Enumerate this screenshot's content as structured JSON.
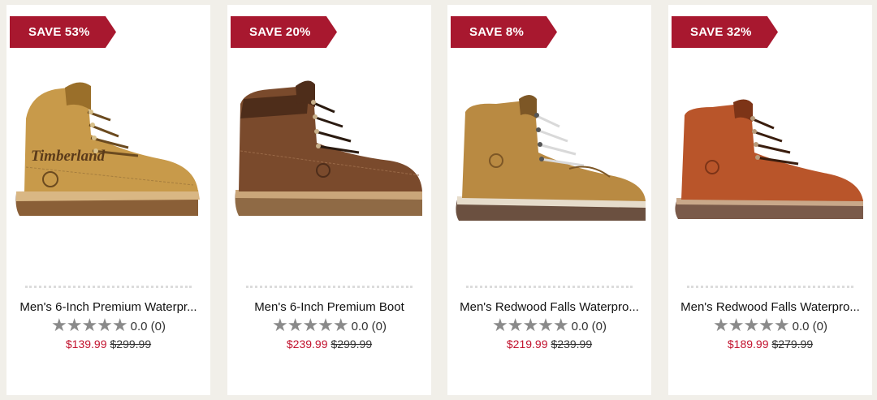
{
  "products": [
    {
      "badge": "SAVE 53%",
      "name": "Men's 6-Inch Premium Waterpr...",
      "stars": "★★★★★",
      "rating": "0.0 (0)",
      "sale_price": "$139.99",
      "original_price": "$299.99",
      "image_logo_text": "Timberland",
      "colors": {
        "upper": "#c89a4a",
        "dark": "#9a6f2a",
        "sole": "#8a5f37",
        "welt": "#d9b784"
      }
    },
    {
      "badge": "SAVE 20%",
      "name": "Men's 6-Inch Premium Boot",
      "stars": "★★★★★",
      "rating": "0.0 (0)",
      "sale_price": "$239.99",
      "original_price": "$299.99",
      "colors": {
        "upper": "#7a4a2c",
        "dark": "#4e2d1a",
        "sole": "#8f6a45",
        "welt": "#caa67a"
      }
    },
    {
      "badge": "SAVE 8%",
      "name": "Men's Redwood Falls Waterpro...",
      "stars": "★★★★★",
      "rating": "0.0 (0)",
      "sale_price": "$219.99",
      "original_price": "$239.99",
      "colors": {
        "upper": "#b98a42",
        "dark": "#7d5726",
        "sole": "#6b5040",
        "welt": "#e6dccb"
      }
    },
    {
      "badge": "SAVE 32%",
      "name": "Men's Redwood Falls Waterpro...",
      "stars": "★★★★★",
      "rating": "0.0 (0)",
      "sale_price": "$189.99",
      "original_price": "$279.99",
      "colors": {
        "upper": "#b9552a",
        "dark": "#7d3417",
        "sole": "#7a5a4a",
        "welt": "#c9a88a"
      }
    }
  ]
}
